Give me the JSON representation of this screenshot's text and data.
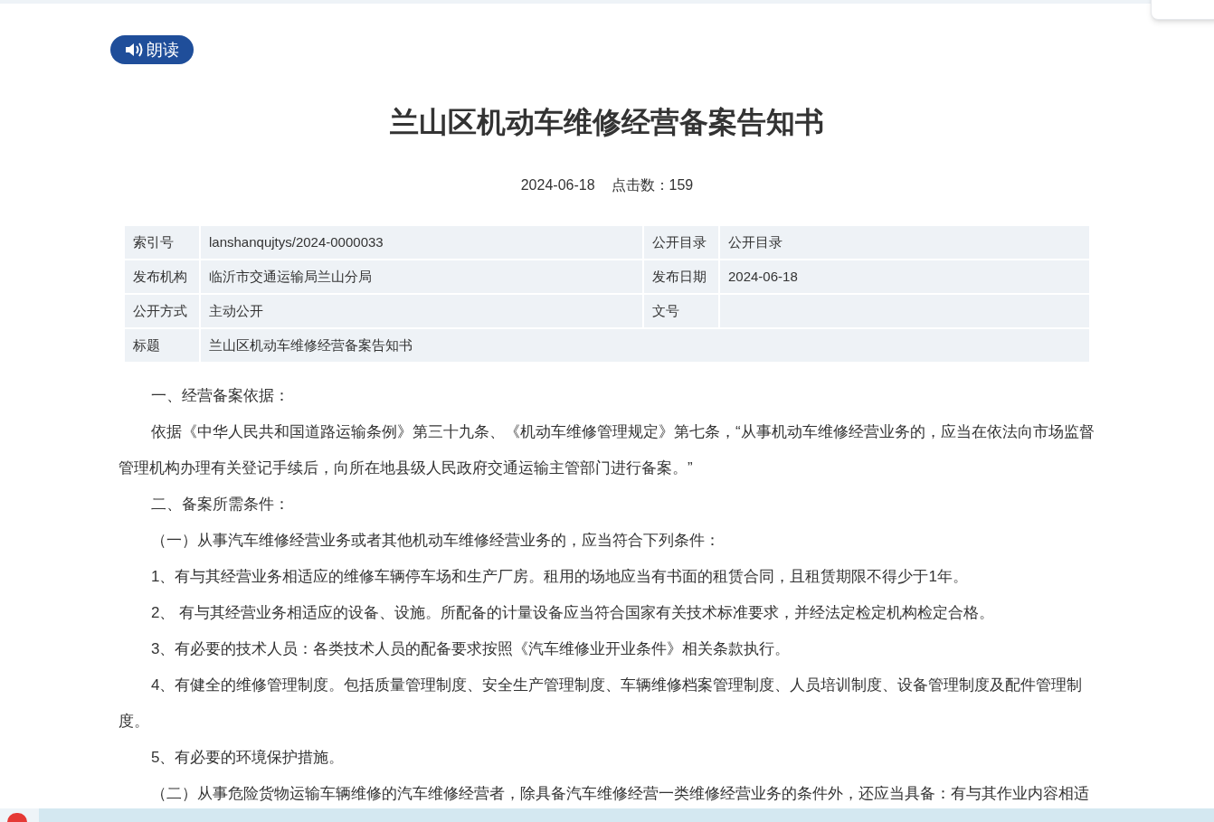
{
  "read_button": {
    "label": "朗读"
  },
  "title": "兰山区机动车维修经营备案告知书",
  "meta": {
    "date": "2024-06-18",
    "hits": "点击数：159"
  },
  "info_table": [
    {
      "label": "索引号",
      "value": "lanshanqujtys/2024-0000033",
      "label_2": "公开目录",
      "value_2": "公开目录"
    },
    {
      "label": "发布机构",
      "value": "临沂市交通运输局兰山分局",
      "label_2": "发布日期",
      "value_2": "2024-06-18"
    },
    {
      "label": "公开方式",
      "value": "主动公开",
      "label_2": "文号"
    },
    {
      "label": "标题",
      "value": "兰山区机动车维修经营备案告知书"
    }
  ],
  "paragraphs": [
    "一、经营备案依据：",
    "依据《中华人民共和国道路运输条例》第三十九条、《机动车维修管理规定》第七条，“从事机动车维修经营业务的，应当在依法向市场监督管理机构办理有关登记手续后，向所在地县级人民政府交通运输主管部门进行备案。”",
    "二、备案所需条件：",
    "（一）从事汽车维修经营业务或者其他机动车维修经营业务的，应当符合下列条件：",
    "1、有与其经营业务相适应的维修车辆停车场和生产厂房。租用的场地应当有书面的租赁合同，且租赁期限不得少于1年。",
    "2、 有与其经营业务相适应的设备、设施。所配备的计量设备应当符合国家有关技术标准要求，并经法定检定机构检定合格。",
    "3、有必要的技术人员：各类技术人员的配备要求按照《汽车维修业开业条件》相关条款执行。",
    "4、有健全的维修管理制度。包括质量管理制度、安全生产管理制度、车辆维修档案管理制度、人员培训制度、设备管理制度及配件管理制度。",
    "5、有必要的环境保护措施。",
    "（二）从事危险货物运输车辆维修的汽车维修经营者，除具备汽车维修经营一类维修经营业务的条件外，还应当具备：有与其作业内容相适"
  ]
}
